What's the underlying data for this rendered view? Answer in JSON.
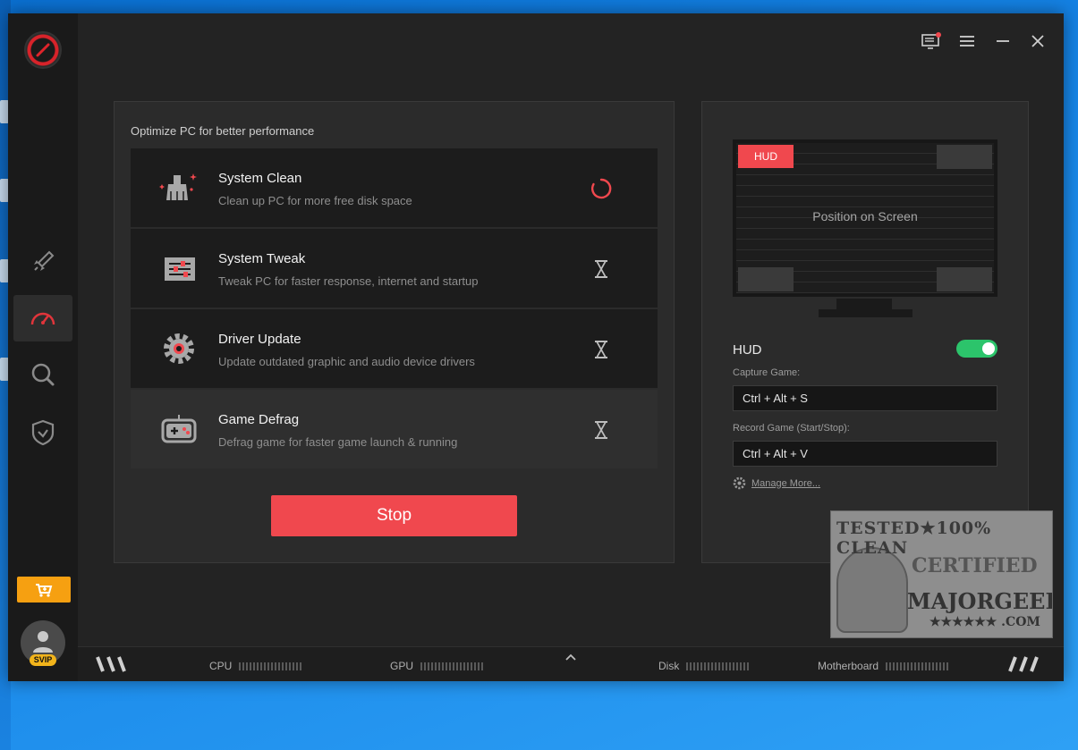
{
  "optimize": {
    "heading": "Optimize PC for better performance",
    "tasks": [
      {
        "title": "System Clean",
        "desc": "Clean up PC for more free disk space",
        "status": "running"
      },
      {
        "title": "System Tweak",
        "desc": "Tweak PC for faster response, internet and startup",
        "status": "waiting"
      },
      {
        "title": "Driver Update",
        "desc": "Update outdated graphic and audio device drivers",
        "status": "waiting"
      },
      {
        "title": "Game Defrag",
        "desc": "Defrag game for faster game launch & running",
        "status": "waiting"
      }
    ],
    "stop_label": "Stop"
  },
  "hud_panel": {
    "hud_tag": "HUD",
    "position_text": "Position on Screen",
    "hud_label": "HUD",
    "hud_enabled": true,
    "capture_label": "Capture Game:",
    "capture_value": "Ctrl + Alt + S",
    "record_label": "Record Game (Start/Stop):",
    "record_value": "Ctrl + Alt + V",
    "manage_link": "Manage More..."
  },
  "sidebar": {
    "svip_badge": "SVIP",
    "nav": [
      "boost-icon",
      "speedometer-icon",
      "search-magnifier-icon",
      "shield-icon"
    ],
    "active_index": 1
  },
  "statusbar": {
    "cpu": "CPU",
    "gpu": "GPU",
    "disk": "Disk",
    "motherboard": "Motherboard"
  },
  "watermark": {
    "line1": "TESTED★100% CLEAN",
    "line2": "CERTIFIED",
    "line3": "MAJORGEEKS",
    "line4": "★★★★★★ .COM"
  },
  "colors": {
    "accent": "#f0484e",
    "toggle_on": "#2cc46b",
    "shop": "#f6a011",
    "background": "#232323"
  }
}
